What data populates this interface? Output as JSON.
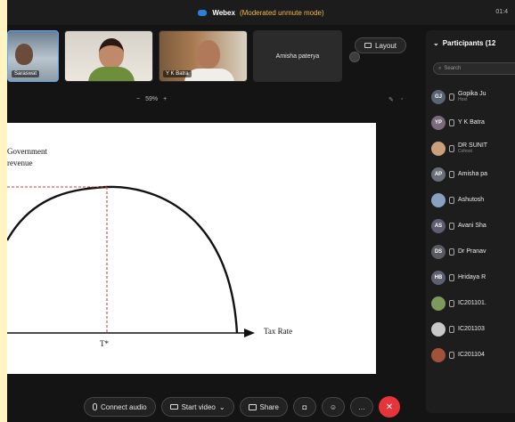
{
  "window": {
    "app_name": "Webex",
    "mode": "(Moderated unmute mode)",
    "clock": "01:4"
  },
  "thumbnails": [
    {
      "name": "Saraswat"
    },
    {
      "name": ""
    },
    {
      "name": "Y K Batra"
    },
    {
      "name": "Amisha paterya"
    }
  ],
  "layout_button": {
    "label": "Layout",
    "icon": "grid-icon"
  },
  "zoom": {
    "minus": "−",
    "level": "59%",
    "plus": "+"
  },
  "slide": {
    "y_label_line1": "Government",
    "y_label_line2": "revenue",
    "x_label": "Tax Rate",
    "x_mark": "T*"
  },
  "participants": {
    "header": "Participants (12",
    "search_placeholder": "Search",
    "items": [
      {
        "initials": "GJ",
        "name": "Gopika Ju",
        "role": "Host",
        "color": "#5a6472"
      },
      {
        "initials": "YP",
        "name": "Y K Batra",
        "role": "",
        "color": "#7a6a7a"
      },
      {
        "initials": "",
        "name": "DR SUNIT",
        "role": "Cohost",
        "color": "#caa07c"
      },
      {
        "initials": "AP",
        "name": "Amisha pa",
        "role": "",
        "color": "#6a6f78"
      },
      {
        "initials": "",
        "name": "Ashutosh",
        "role": "",
        "color": "#8aa0c0"
      },
      {
        "initials": "AS",
        "name": "Avani Sha",
        "role": "",
        "color": "#5e5e70"
      },
      {
        "initials": "DS",
        "name": "Dr Pranav",
        "role": "",
        "color": "#5a5a62"
      },
      {
        "initials": "HB",
        "name": "Hridaya R",
        "role": "",
        "color": "#5d6070"
      },
      {
        "initials": "",
        "name": "IC201101.",
        "role": "",
        "color": "#7c9a5c"
      },
      {
        "initials": "",
        "name": "IC201103",
        "role": "",
        "color": "#c8c8c8"
      },
      {
        "initials": "",
        "name": "IC201104",
        "role": "",
        "color": "#a0523a"
      }
    ]
  },
  "toolbar": {
    "audio": "Connect audio",
    "video": "Start video",
    "share": "Share",
    "end_icon": "✕"
  }
}
